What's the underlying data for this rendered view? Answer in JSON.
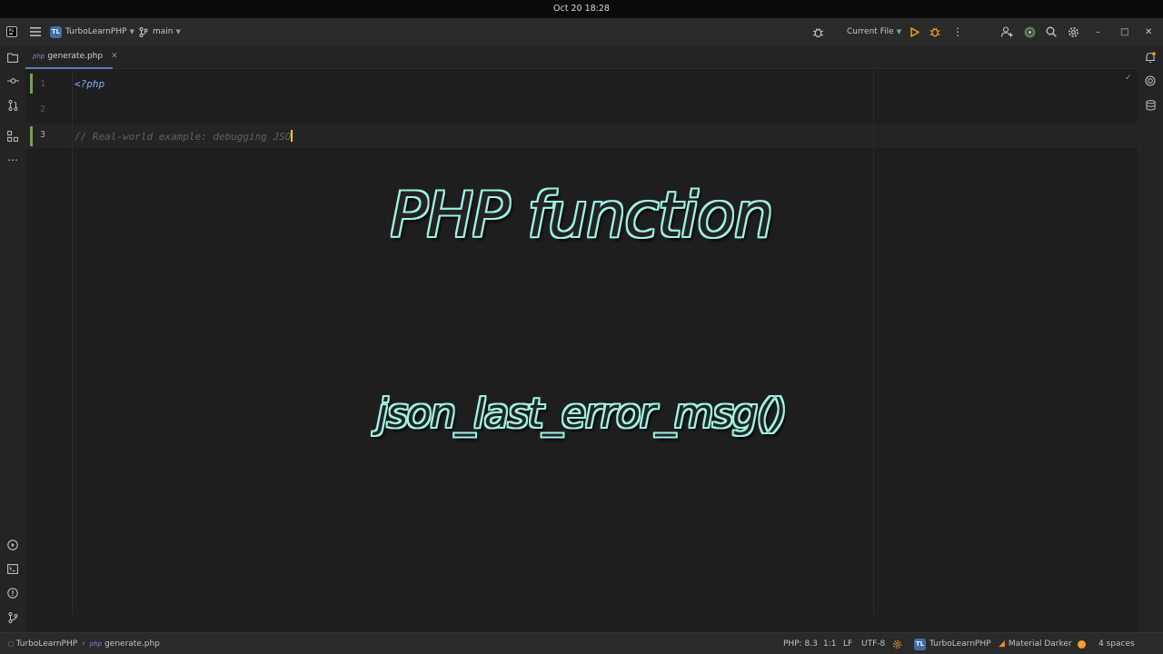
{
  "system": {
    "clock": "Oct 20  18:28"
  },
  "titlebar": {
    "project_badge": "TL",
    "project_name": "TurboLearnPHP",
    "branch": "main",
    "run_config": "Current File",
    "window_controls": [
      "–",
      "□",
      "✕"
    ]
  },
  "tabs": [
    {
      "label": "generate.php",
      "close": "✕",
      "mini": "php"
    }
  ],
  "editor": {
    "lines": [
      {
        "num": "1",
        "text": "<?php"
      },
      {
        "num": "2",
        "text": ""
      },
      {
        "num": "3",
        "text": "// Real-world example: debugging JSO"
      }
    ]
  },
  "overlay": {
    "title": "PHP function",
    "function_name": "json_last_error_msg()",
    "accent_color": "#9ff3e4"
  },
  "statusbar": {
    "breadcrumb_project": "TurboLearnPHP",
    "breadcrumb_file": "generate.php",
    "php_version": "PHP: 8.3",
    "position": "1:1",
    "line_sep": "LF",
    "encoding": "UTF-8",
    "project_badge": "TL",
    "project_name": "TurboLearnPHP",
    "theme": "Material Darker",
    "indent": "4 spaces"
  },
  "icons": {
    "left_top": [
      "folder-icon",
      "commit-icon",
      "pull-requests-icon",
      "structure-icon",
      "more-icon"
    ],
    "left_bottom": [
      "services-icon",
      "terminal-icon",
      "problems-icon",
      "git-icon"
    ],
    "right": [
      "notifications-icon",
      "ai-assistant-icon",
      "database-icon"
    ]
  }
}
